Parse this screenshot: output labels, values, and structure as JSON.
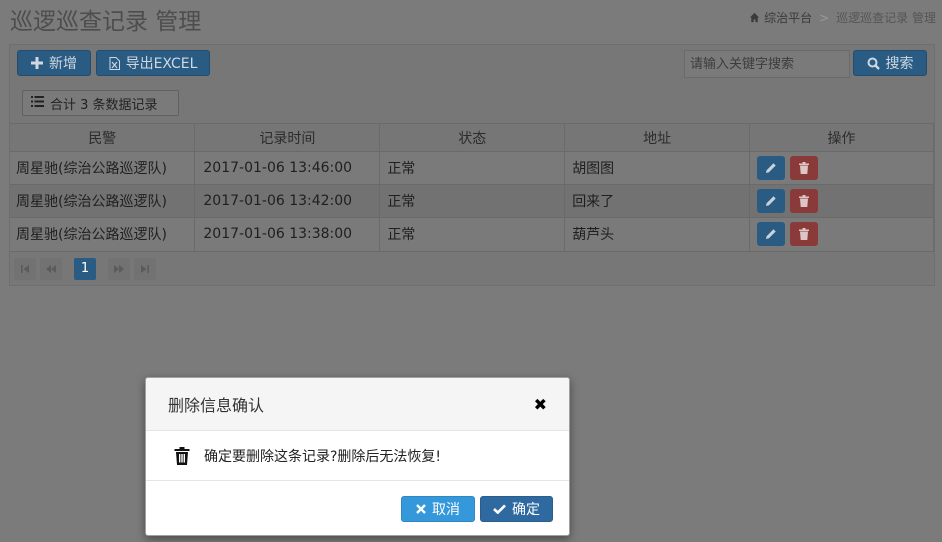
{
  "header": {
    "title": "巡逻巡查记录 管理",
    "breadcrumb": {
      "home": "综治平台",
      "separator": ">",
      "current": "巡逻巡查记录 管理"
    }
  },
  "toolbar": {
    "add_label": "新增",
    "export_label": "导出EXCEL",
    "search_placeholder": "请输入关键字搜索",
    "search_label": "搜索",
    "record_count_label": "合计 3 条数据记录"
  },
  "table": {
    "columns": [
      "民警",
      "记录时间",
      "状态",
      "地址",
      "操作"
    ],
    "rows": [
      {
        "officer": "周星驰(综治公路巡逻队)",
        "time": "2017-01-06 13:46:00",
        "status": "正常",
        "address": "胡图图"
      },
      {
        "officer": "周星驰(综治公路巡逻队)",
        "time": "2017-01-06 13:42:00",
        "status": "正常",
        "address": "回来了"
      },
      {
        "officer": "周星驰(综治公路巡逻队)",
        "time": "2017-01-06 13:38:00",
        "status": "正常",
        "address": "葫芦头"
      }
    ]
  },
  "pager": {
    "current_page": "1"
  },
  "modal": {
    "title": "删除信息确认",
    "message": "确定要删除这条记录?删除后无法恢复!",
    "cancel_label": "取消",
    "ok_label": "确定"
  },
  "colors": {
    "primary_dim": "#2a5b82",
    "danger_dim": "#8a3a39",
    "cancel": "#3498db",
    "ok": "#2e6aa0",
    "overlay_bg": "#7b7b7b"
  },
  "icons": {
    "add": "plus-icon",
    "export": "excel-file-icon",
    "search": "search-icon",
    "list": "list-icon",
    "edit": "pencil-icon",
    "delete": "trash-icon",
    "home": "home-icon",
    "close": "close-icon",
    "cancel": "x-icon",
    "ok": "check-icon"
  }
}
